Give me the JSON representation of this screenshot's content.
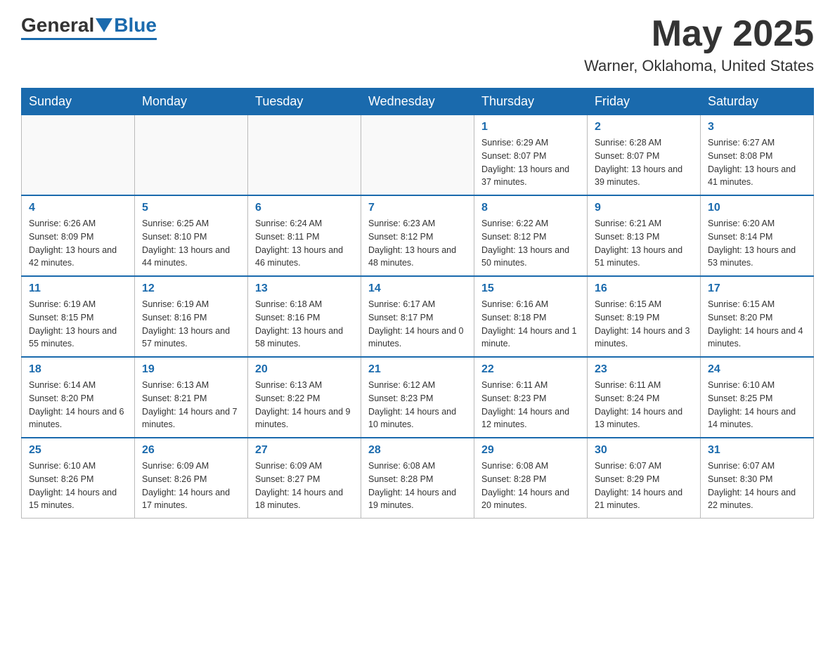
{
  "header": {
    "logo": {
      "general": "General",
      "blue": "Blue"
    },
    "title": "May 2025",
    "location": "Warner, Oklahoma, United States"
  },
  "weekdays": [
    "Sunday",
    "Monday",
    "Tuesday",
    "Wednesday",
    "Thursday",
    "Friday",
    "Saturday"
  ],
  "weeks": [
    [
      {
        "day": "",
        "info": ""
      },
      {
        "day": "",
        "info": ""
      },
      {
        "day": "",
        "info": ""
      },
      {
        "day": "",
        "info": ""
      },
      {
        "day": "1",
        "info": "Sunrise: 6:29 AM\nSunset: 8:07 PM\nDaylight: 13 hours and 37 minutes."
      },
      {
        "day": "2",
        "info": "Sunrise: 6:28 AM\nSunset: 8:07 PM\nDaylight: 13 hours and 39 minutes."
      },
      {
        "day": "3",
        "info": "Sunrise: 6:27 AM\nSunset: 8:08 PM\nDaylight: 13 hours and 41 minutes."
      }
    ],
    [
      {
        "day": "4",
        "info": "Sunrise: 6:26 AM\nSunset: 8:09 PM\nDaylight: 13 hours and 42 minutes."
      },
      {
        "day": "5",
        "info": "Sunrise: 6:25 AM\nSunset: 8:10 PM\nDaylight: 13 hours and 44 minutes."
      },
      {
        "day": "6",
        "info": "Sunrise: 6:24 AM\nSunset: 8:11 PM\nDaylight: 13 hours and 46 minutes."
      },
      {
        "day": "7",
        "info": "Sunrise: 6:23 AM\nSunset: 8:12 PM\nDaylight: 13 hours and 48 minutes."
      },
      {
        "day": "8",
        "info": "Sunrise: 6:22 AM\nSunset: 8:12 PM\nDaylight: 13 hours and 50 minutes."
      },
      {
        "day": "9",
        "info": "Sunrise: 6:21 AM\nSunset: 8:13 PM\nDaylight: 13 hours and 51 minutes."
      },
      {
        "day": "10",
        "info": "Sunrise: 6:20 AM\nSunset: 8:14 PM\nDaylight: 13 hours and 53 minutes."
      }
    ],
    [
      {
        "day": "11",
        "info": "Sunrise: 6:19 AM\nSunset: 8:15 PM\nDaylight: 13 hours and 55 minutes."
      },
      {
        "day": "12",
        "info": "Sunrise: 6:19 AM\nSunset: 8:16 PM\nDaylight: 13 hours and 57 minutes."
      },
      {
        "day": "13",
        "info": "Sunrise: 6:18 AM\nSunset: 8:16 PM\nDaylight: 13 hours and 58 minutes."
      },
      {
        "day": "14",
        "info": "Sunrise: 6:17 AM\nSunset: 8:17 PM\nDaylight: 14 hours and 0 minutes."
      },
      {
        "day": "15",
        "info": "Sunrise: 6:16 AM\nSunset: 8:18 PM\nDaylight: 14 hours and 1 minute."
      },
      {
        "day": "16",
        "info": "Sunrise: 6:15 AM\nSunset: 8:19 PM\nDaylight: 14 hours and 3 minutes."
      },
      {
        "day": "17",
        "info": "Sunrise: 6:15 AM\nSunset: 8:20 PM\nDaylight: 14 hours and 4 minutes."
      }
    ],
    [
      {
        "day": "18",
        "info": "Sunrise: 6:14 AM\nSunset: 8:20 PM\nDaylight: 14 hours and 6 minutes."
      },
      {
        "day": "19",
        "info": "Sunrise: 6:13 AM\nSunset: 8:21 PM\nDaylight: 14 hours and 7 minutes."
      },
      {
        "day": "20",
        "info": "Sunrise: 6:13 AM\nSunset: 8:22 PM\nDaylight: 14 hours and 9 minutes."
      },
      {
        "day": "21",
        "info": "Sunrise: 6:12 AM\nSunset: 8:23 PM\nDaylight: 14 hours and 10 minutes."
      },
      {
        "day": "22",
        "info": "Sunrise: 6:11 AM\nSunset: 8:23 PM\nDaylight: 14 hours and 12 minutes."
      },
      {
        "day": "23",
        "info": "Sunrise: 6:11 AM\nSunset: 8:24 PM\nDaylight: 14 hours and 13 minutes."
      },
      {
        "day": "24",
        "info": "Sunrise: 6:10 AM\nSunset: 8:25 PM\nDaylight: 14 hours and 14 minutes."
      }
    ],
    [
      {
        "day": "25",
        "info": "Sunrise: 6:10 AM\nSunset: 8:26 PM\nDaylight: 14 hours and 15 minutes."
      },
      {
        "day": "26",
        "info": "Sunrise: 6:09 AM\nSunset: 8:26 PM\nDaylight: 14 hours and 17 minutes."
      },
      {
        "day": "27",
        "info": "Sunrise: 6:09 AM\nSunset: 8:27 PM\nDaylight: 14 hours and 18 minutes."
      },
      {
        "day": "28",
        "info": "Sunrise: 6:08 AM\nSunset: 8:28 PM\nDaylight: 14 hours and 19 minutes."
      },
      {
        "day": "29",
        "info": "Sunrise: 6:08 AM\nSunset: 8:28 PM\nDaylight: 14 hours and 20 minutes."
      },
      {
        "day": "30",
        "info": "Sunrise: 6:07 AM\nSunset: 8:29 PM\nDaylight: 14 hours and 21 minutes."
      },
      {
        "day": "31",
        "info": "Sunrise: 6:07 AM\nSunset: 8:30 PM\nDaylight: 14 hours and 22 minutes."
      }
    ]
  ]
}
